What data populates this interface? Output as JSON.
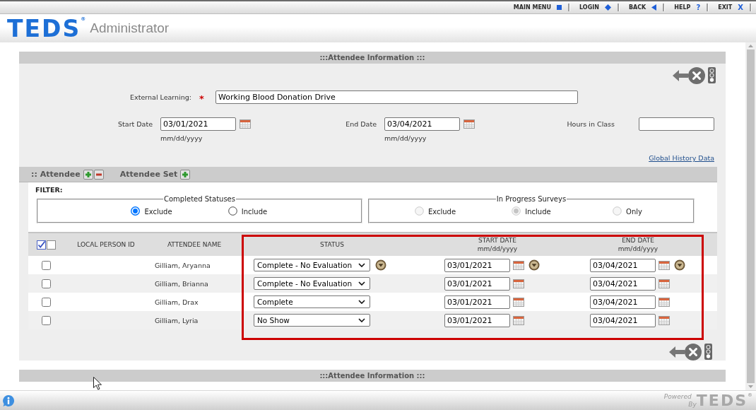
{
  "top_nav": [
    {
      "label": "MAIN MENU"
    },
    {
      "label": "LOGIN"
    },
    {
      "label": "BACK"
    },
    {
      "label": "HELP",
      "glyph": "?"
    },
    {
      "label": "EXIT",
      "glyph": "X"
    }
  ],
  "header": {
    "logo": "TEDS$^{®}$",
    "title": "Administrator"
  },
  "panel": {
    "title": ":::Attendee Information :::",
    "footer_title": ":::Attendee Information :::"
  },
  "form": {
    "external_learning": {
      "label": "External Learning:",
      "required_mark": "*",
      "value": "Working Blood Donation Drive"
    },
    "start_date": {
      "label": "Start Date",
      "value": "03/01/2021",
      "hint": "mm/dd/yyyy"
    },
    "end_date": {
      "label": "End Date",
      "value": "03/04/2021",
      "hint": "mm/dd/yyyy"
    },
    "hours_in_class": {
      "label": "Hours in Class"
    },
    "history_link": "Global History Data"
  },
  "attendee_bar": {
    "title": ":: Attendee",
    "set_title": "Attendee Set"
  },
  "filter": {
    "label": "FILTER:",
    "groups": [
      {
        "legend": "Completed Statuses",
        "options": [
          {
            "label": "Exclude",
            "selected": true,
            "disabled": false
          },
          {
            "label": "Include",
            "selected": false,
            "disabled": false
          }
        ]
      },
      {
        "legend": "In Progress Surveys",
        "options": [
          {
            "label": "Exclude",
            "selected": false,
            "disabled": true
          },
          {
            "label": "Include",
            "selected": true,
            "disabled": true
          },
          {
            "label": "Only",
            "selected": false,
            "disabled": true
          }
        ]
      }
    ]
  },
  "table": {
    "highlight_frame": true,
    "columns": [
      {
        "kind": "toggle"
      },
      {
        "kind": "text",
        "label": "LOCAL PERSON ID"
      },
      {
        "kind": "text",
        "label": "ATTENDEE NAME"
      },
      {
        "kind": "text",
        "label": "STATUS"
      },
      {
        "kind": "date",
        "label": "START DATE",
        "hint": "mm/dd/yyyy"
      },
      {
        "kind": "date",
        "label": "END DATE",
        "hint": "mm/dd/yyyy"
      }
    ],
    "rows": [
      {
        "checked": false,
        "name": "Gilliam, Aryanna",
        "status": "Complete - No Evaluation",
        "start_date": "03/01/2021",
        "end_date": "03/04/2021",
        "fill_down": true
      },
      {
        "checked": false,
        "name": "Gilliam, Brianna",
        "status": "Complete - No Evaluation",
        "start_date": "03/01/2021",
        "end_date": "03/04/2021",
        "fill_down": false
      },
      {
        "checked": false,
        "name": "Gilliam, Drax",
        "status": "Complete",
        "start_date": "03/01/2021",
        "end_date": "03/04/2021",
        "fill_down": false
      },
      {
        "checked": false,
        "name": "Gilliam, Lyria",
        "status": "No Show",
        "start_date": "03/01/2021",
        "end_date": "03/04/2021",
        "fill_down": false
      }
    ]
  },
  "footer": {
    "powered": "Powered",
    "by": "By",
    "logo": "TEDS$^{®}$"
  }
}
